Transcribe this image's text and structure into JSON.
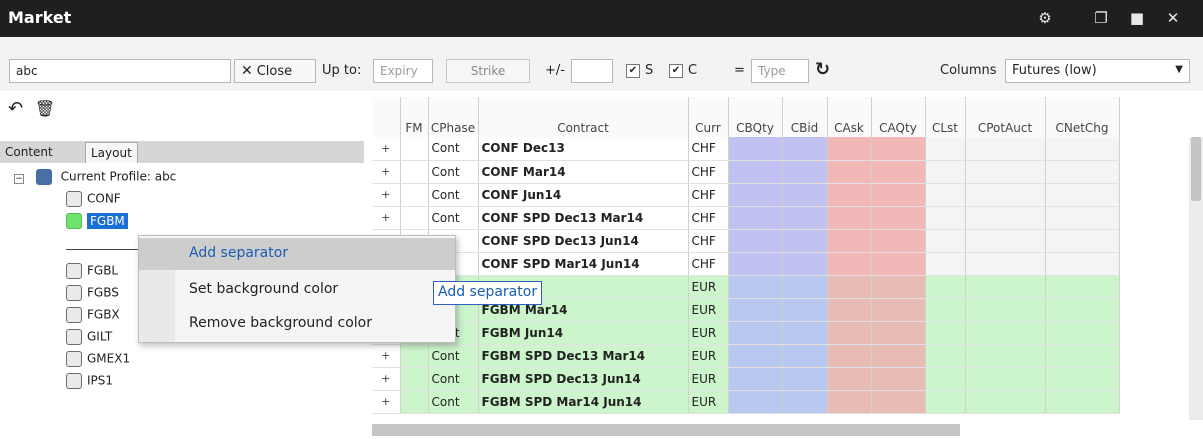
{
  "window": {
    "title": "Market",
    "icons": [
      "gear-icon",
      "detach-icon",
      "maximize-icon",
      "close-icon"
    ]
  },
  "toolbar": {
    "search_value": "abc",
    "close_label": "Close",
    "upto_label": "Up to:",
    "expiry_placeholder": "Expiry",
    "strike_label": "Strike",
    "plusminus_label": "+/-",
    "s_label": "S",
    "c_label": "C",
    "equals_label": "=",
    "type_placeholder": "Type",
    "columns_label": "Columns",
    "columns_value": "Futures (low)"
  },
  "tabs": [
    {
      "label": "Content"
    },
    {
      "label": "Layout"
    }
  ],
  "tree": {
    "root": "Current Profile: abc",
    "items": [
      "CONF",
      "FGBM",
      "FGBL",
      "FGBS",
      "FGBX",
      "GILT",
      "GMEX1",
      "IPS1"
    ],
    "selected": "FGBM"
  },
  "context_menu": {
    "items": [
      "Add separator",
      "Set background color",
      "Remove background color"
    ],
    "tooltip": "Add separator"
  },
  "grid": {
    "columns": [
      "FM",
      "CPhase",
      "Contract",
      "Curr",
      "CBQty",
      "CBid",
      "CAsk",
      "CAQty",
      "CLst",
      "CPotAuct",
      "CNetChg"
    ],
    "rows": [
      {
        "expand": "+",
        "phase": "Cont",
        "contract": "CONF Dec13",
        "curr": "CHF"
      },
      {
        "expand": "+",
        "phase": "Cont",
        "contract": "CONF Mar14",
        "curr": "CHF"
      },
      {
        "expand": "+",
        "phase": "Cont",
        "contract": "CONF Jun14",
        "curr": "CHF"
      },
      {
        "expand": "+",
        "phase": "Cont",
        "contract": "CONF SPD Dec13 Mar14",
        "curr": "CHF"
      },
      {
        "expand": "+",
        "phase": "nt",
        "contract": "CONF SPD Dec13 Jun14",
        "curr": "CHF"
      },
      {
        "expand": "+",
        "phase": "nt",
        "contract": "CONF SPD Mar14 Jun14",
        "curr": "CHF"
      },
      {
        "expand": "+",
        "phase": "nt",
        "contract": "Dec13",
        "curr": "EUR"
      },
      {
        "expand": "+",
        "phase": "nt",
        "contract": "FGBM Mar14",
        "curr": "EUR"
      },
      {
        "expand": "+",
        "phase": "Cont",
        "contract": "FGBM Jun14",
        "curr": "EUR"
      },
      {
        "expand": "+",
        "phase": "Cont",
        "contract": "FGBM SPD Dec13 Mar14",
        "curr": "EUR"
      },
      {
        "expand": "+",
        "phase": "Cont",
        "contract": "FGBM SPD Dec13 Jun14",
        "curr": "EUR"
      },
      {
        "expand": "+",
        "phase": "Cont",
        "contract": "FGBM SPD Mar14 Jun14",
        "curr": "EUR"
      }
    ],
    "colors": {
      "chf_row": "#ffffff",
      "eur_row": "#ccf5cc",
      "bid_chf": "#c2c2f2",
      "ask_chf": "#f2b8b8",
      "bid_eur": "#b8c8ef",
      "ask_eur": "#e8bcb4",
      "rest_eur": "#ccf5cc"
    }
  }
}
